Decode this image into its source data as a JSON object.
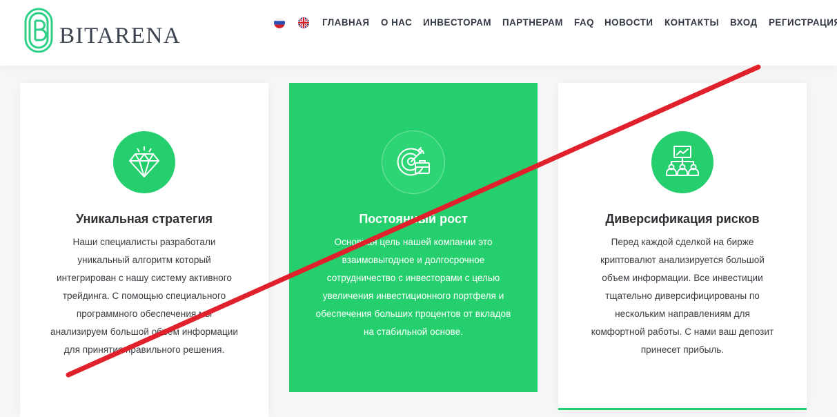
{
  "brand": {
    "name": "BITARENA",
    "logo_letter": "B",
    "accent_color": "#26cf6e"
  },
  "languages": [
    {
      "code": "ru",
      "icon": "russian-flag-icon"
    },
    {
      "code": "en",
      "icon": "uk-flag-icon"
    }
  ],
  "nav": {
    "items": [
      "ГЛАВНАЯ",
      "О НАС",
      "ИНВЕСТОРАМ",
      "ПАРТНЕРАМ",
      "FAQ",
      "НОВОСТИ",
      "КОНТАКТЫ",
      "ВХОД",
      "РЕГИСТРАЦИЯ"
    ]
  },
  "features": [
    {
      "icon": "diamond-icon",
      "title": "Уникальная стратегия",
      "text": "Наши специалисты разработали уникальный алгоритм который интегрирован с нашу систему активного трейдинга. С помощью специального программного обеспечения мы анализируем большой объем информации для принятия правильного решения."
    },
    {
      "icon": "target-briefcase-icon",
      "title": "Постоянный рост",
      "text": "Основная цель нашей компании это взаимовыгодное и долгосрочное сотрудничество с инвесторами с целью увеличения инвестиционного портфеля и обеспечения больших процентов от вкладов на стабильной основе."
    },
    {
      "icon": "team-chart-icon",
      "title": "Диверсификация рисков",
      "text": "Перед каждой сделкой на бирже криптовалют анализируется большой объем информации. Все инвестиции тщательно диверсифицированы по нескольким направлениям для комфортной работы. С нами ваш депозит принесет прибыль."
    }
  ],
  "overlay": {
    "strike_color": "#e0202a"
  }
}
